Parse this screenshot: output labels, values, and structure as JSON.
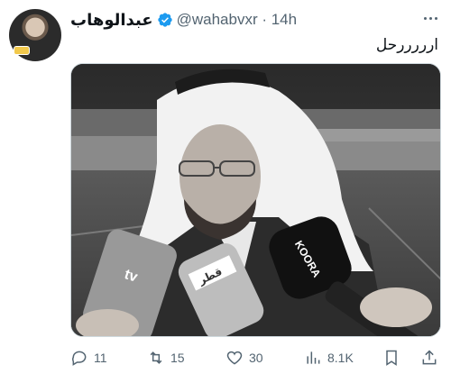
{
  "author": {
    "display_name": "عبدالوهاب",
    "handle_time": "@wahabvxr · 14h",
    "verified_color": "#1d9bf0"
  },
  "tweet": {
    "text": "ارررررحل"
  },
  "media": {
    "signs": {
      "mic_left": "tv",
      "mic_center": "قطر",
      "mic_right": "KOORA"
    }
  },
  "actions": {
    "replies": "11",
    "retweets": "15",
    "likes": "30",
    "views": "8.1K"
  }
}
